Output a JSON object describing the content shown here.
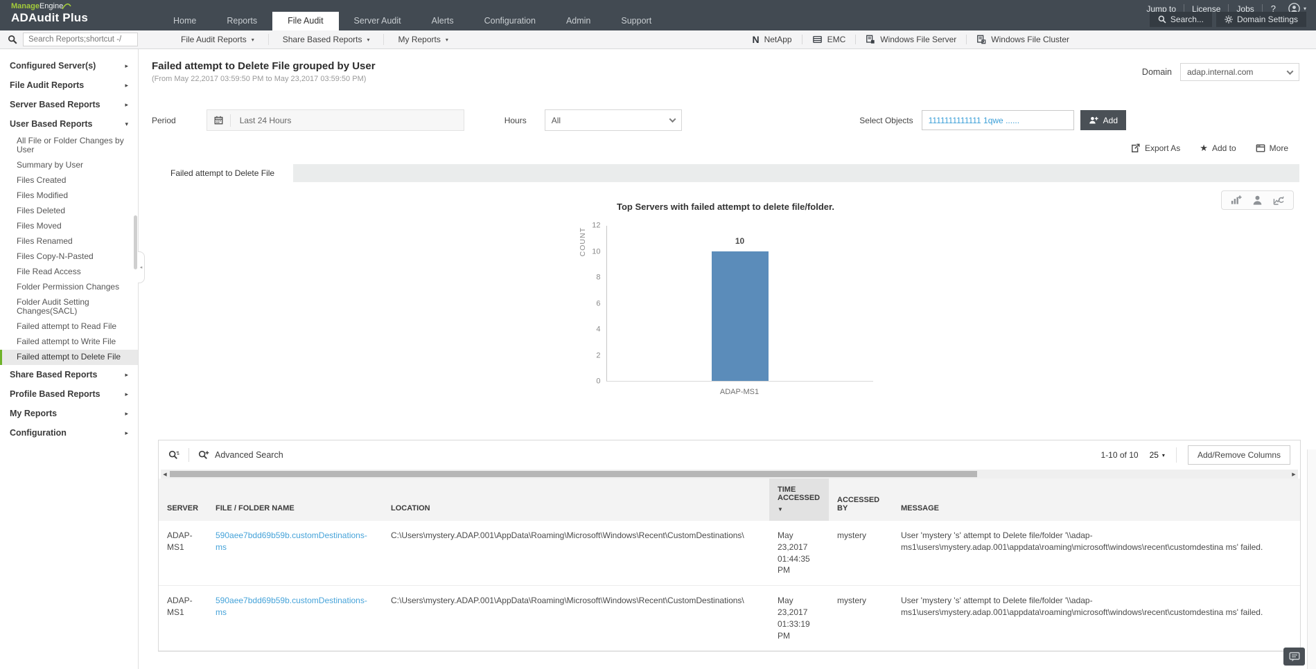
{
  "header": {
    "brand": {
      "manage": "Manage",
      "engine": "Engine",
      "product": "ADAudit Plus"
    },
    "nav_items": [
      "Home",
      "Reports",
      "File Audit",
      "Server Audit",
      "Alerts",
      "Configuration",
      "Admin",
      "Support"
    ],
    "active_nav": "File Audit",
    "utility": {
      "jump_to": "Jump to",
      "license": "License",
      "jobs": "Jobs",
      "help": "?"
    },
    "search_button": "Search...",
    "domain_settings_button": "Domain Settings"
  },
  "toolbar": {
    "search_placeholder": "Search Reports;shortcut -/",
    "menus": [
      "File Audit Reports",
      "Share Based Reports",
      "My Reports"
    ],
    "platforms": [
      "NetApp",
      "EMC",
      "Windows File Server",
      "Windows File Cluster"
    ]
  },
  "sidebar": {
    "top_sections": [
      "Configured Server(s)",
      "File Audit Reports",
      "Server Based Reports",
      "User Based Reports"
    ],
    "children": [
      "All File or Folder Changes by User",
      "Summary by User",
      "Files Created",
      "Files Modified",
      "Files Deleted",
      "Files Moved",
      "Files Renamed",
      "Files Copy-N-Pasted",
      "File Read Access",
      "Folder Permission Changes",
      "Folder Audit Setting Changes(SACL)",
      "Failed attempt to Read File",
      "Failed attempt to Write File",
      "Failed attempt to Delete File"
    ],
    "bottom_sections": [
      "Share Based Reports",
      "Profile Based Reports",
      "My Reports",
      "Configuration"
    ],
    "selected_item": "Failed attempt to Delete File"
  },
  "report": {
    "title": "Failed attempt to Delete File grouped by User",
    "date_range": "(From May 22,2017 03:59:50 PM to May 23,2017 03:59:50 PM)",
    "domain_label": "Domain",
    "domain_value": "adap.internal.com",
    "period_label": "Period",
    "period_value": "Last 24 Hours",
    "hours_label": "Hours",
    "hours_value": "All",
    "select_objects_label": "Select Objects",
    "select_objects_value": "1111111111111 1qwe ......",
    "add_button": "Add",
    "actions": {
      "export": "Export As",
      "add_to": "Add to",
      "more": "More"
    },
    "tab": "Failed attempt to Delete File"
  },
  "chart_data": {
    "type": "bar",
    "title": "Top Servers with failed attempt to delete file/folder.",
    "ylabel": "COUNT",
    "xlabel": "",
    "categories": [
      "ADAP-MS1"
    ],
    "values": [
      10
    ],
    "ylim": [
      0,
      12
    ],
    "yticks": [
      0,
      2,
      4,
      6,
      8,
      10,
      12
    ],
    "bar_color": "#5b8cba",
    "data_labels": true,
    "grid": false,
    "legend": "none"
  },
  "table": {
    "advanced_search_label": "Advanced Search",
    "pagination": "1-10 of 10",
    "page_size": "25",
    "add_remove_columns": "Add/Remove Columns",
    "columns": [
      "SERVER",
      "FILE / FOLDER NAME",
      "LOCATION",
      "TIME ACCESSED",
      "ACCESSED BY",
      "MESSAGE"
    ],
    "sort_column": "TIME ACCESSED",
    "sort_direction": "desc",
    "rows": [
      {
        "server": "ADAP-MS1",
        "file": "590aee7bdd69b59b.customDestinations-ms",
        "location": "C:\\Users\\mystery.ADAP.001\\AppData\\Roaming\\Microsoft\\Windows\\Recent\\CustomDestinations\\",
        "time": "May 23,2017 01:44:35 PM",
        "accessed_by": "mystery",
        "message": "User 'mystery 's' attempt to Delete file/folder '\\\\adap-ms1\\users\\mystery.adap.001\\appdata\\roaming\\microsoft\\windows\\recent\\customdestina ms' failed."
      },
      {
        "server": "ADAP-MS1",
        "file": "590aee7bdd69b59b.customDestinations-ms",
        "location": "C:\\Users\\mystery.ADAP.001\\AppData\\Roaming\\Microsoft\\Windows\\Recent\\CustomDestinations\\",
        "time": "May 23,2017 01:33:19 PM",
        "accessed_by": "mystery",
        "message": "User 'mystery 's' attempt to Delete file/folder '\\\\adap-ms1\\users\\mystery.adap.001\\appdata\\roaming\\microsoft\\windows\\recent\\customdestina ms' failed."
      }
    ]
  },
  "icons": {
    "caret_down": "▾",
    "caret_right": "▸",
    "sort_desc": "▼",
    "scroll_left": "◀",
    "scroll_right": "▶",
    "star": "★",
    "netapp_n": "N",
    "collapse_left": "◂",
    "user_caret": "▾"
  }
}
